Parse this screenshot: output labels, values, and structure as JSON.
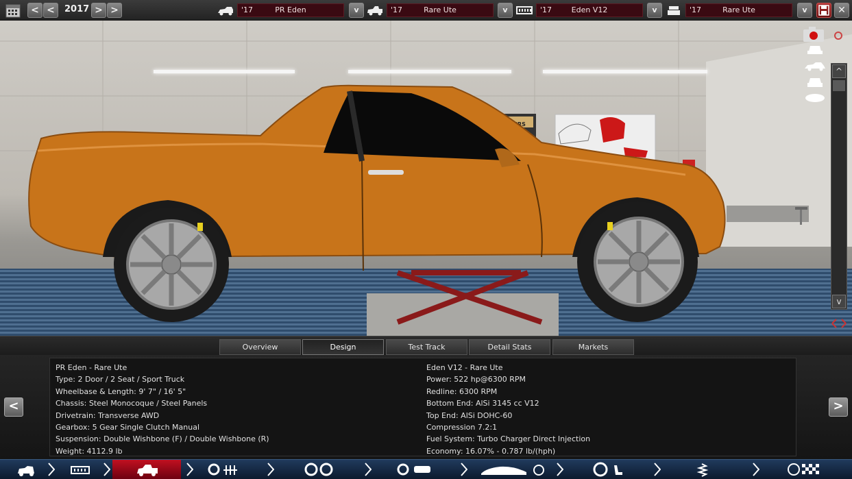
{
  "topbar": {
    "year": "2017",
    "selectors": [
      {
        "year": "'17",
        "name": "PR Eden",
        "icon": "car-body-icon"
      },
      {
        "year": "'17",
        "name": "Rare Ute",
        "icon": "ute-trim-icon"
      },
      {
        "year": "'17",
        "name": "Eden V12",
        "icon": "engine-icon"
      },
      {
        "year": "'17",
        "name": "Rare Ute",
        "icon": "engine-trim-icon"
      }
    ],
    "dropdown_glyph": "v",
    "prev_glyph": "<",
    "next_glyph": ">",
    "close_glyph": "✕"
  },
  "scene": {
    "poster_text": "OLOURS",
    "scroll_up_glyph": "^",
    "scroll_down_glyph": "v"
  },
  "tabs": [
    {
      "label": "Overview",
      "active": false
    },
    {
      "label": "Design",
      "active": true
    },
    {
      "label": "Test Track",
      "active": false
    },
    {
      "label": "Detail Stats",
      "active": false
    },
    {
      "label": "Markets",
      "active": false
    }
  ],
  "info": {
    "left_arrow": "<",
    "right_arrow": ">",
    "car": [
      "PR Eden - Rare Ute",
      "Type: 2 Door / 2 Seat / Sport Truck",
      "Wheelbase & Length: 9' 7\" / 16' 5\"",
      "Chassis: Steel Monocoque / Steel Panels",
      "Drivetrain: Transverse AWD",
      "Gearbox: 5 Gear Single Clutch Manual",
      "Suspension: Double Wishbone (F) / Double Wishbone (R)",
      "Weight: 4112.9 lb"
    ],
    "engine": [
      "Eden V12 - Rare Ute",
      "Power: 522 hp@6300 RPM",
      "Redline: 6300 RPM",
      "Bottom End: AlSi 3145 cc V12",
      "Top End: AlSi DOHC-60",
      "Compression 7.2:1",
      "Fuel System: Turbo Charger Direct Injection",
      "Economy: 16.07% - 0.787 lb/(hph)"
    ]
  },
  "colors": {
    "car_paint": "#c8741a",
    "accent_red": "#b01828",
    "nav_blue": "#1c3556"
  }
}
